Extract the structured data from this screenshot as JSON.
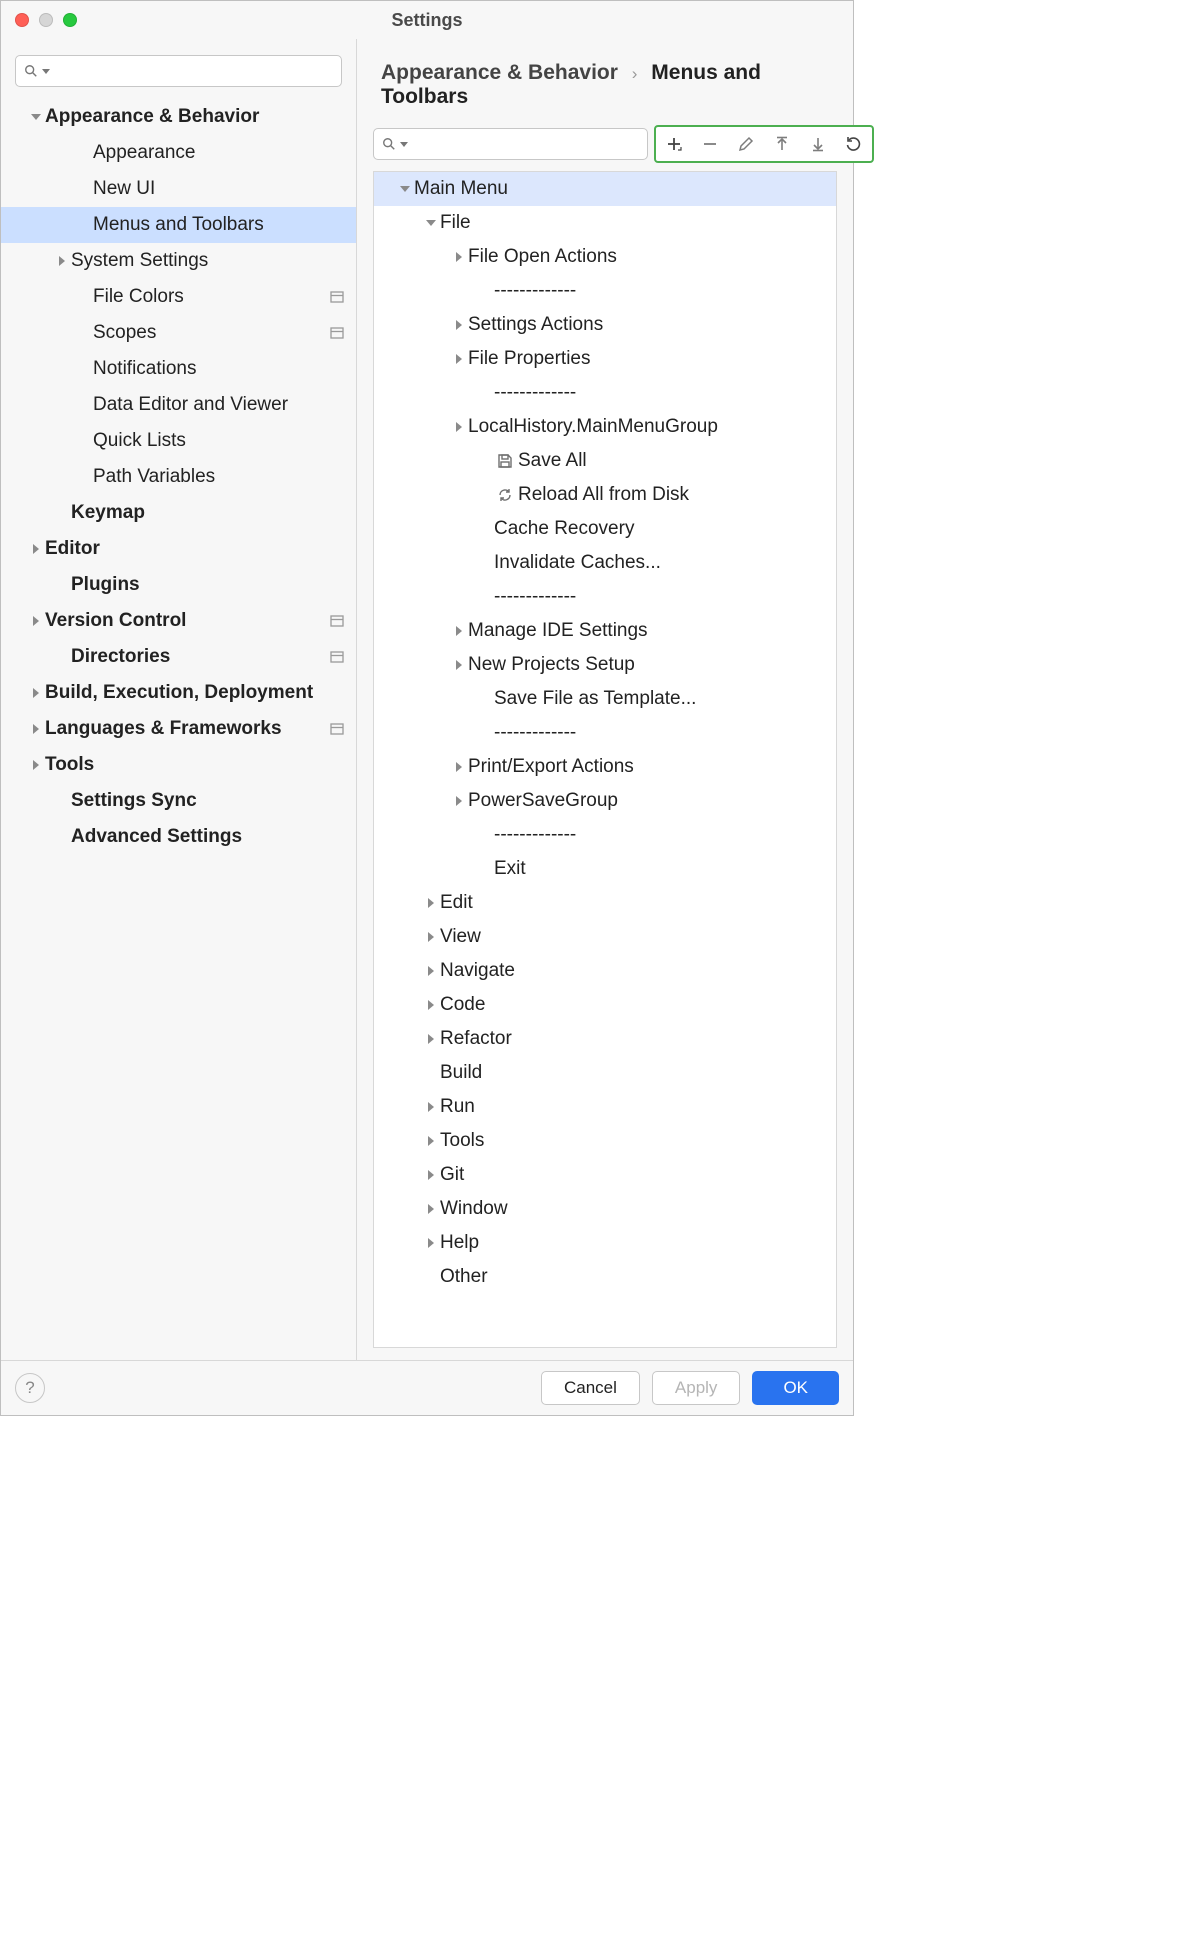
{
  "window": {
    "title": "Settings"
  },
  "breadcrumbs": {
    "parent": "Appearance & Behavior",
    "current": "Menus and Toolbars"
  },
  "sidebar": {
    "search_placeholder": "",
    "nodes": [
      {
        "label": "Appearance & Behavior",
        "bold": true,
        "indent": 0,
        "expander": "down"
      },
      {
        "label": "Appearance",
        "indent": 2
      },
      {
        "label": "New UI",
        "indent": 2
      },
      {
        "label": "Menus and Toolbars",
        "indent": 2,
        "selected": true
      },
      {
        "label": "System Settings",
        "indent": 1,
        "expander": "right"
      },
      {
        "label": "File Colors",
        "indent": 2,
        "tag": true
      },
      {
        "label": "Scopes",
        "indent": 2,
        "tag": true
      },
      {
        "label": "Notifications",
        "indent": 2
      },
      {
        "label": "Data Editor and Viewer",
        "indent": 2
      },
      {
        "label": "Quick Lists",
        "indent": 2
      },
      {
        "label": "Path Variables",
        "indent": 2
      },
      {
        "label": "Keymap",
        "bold": true,
        "indent": 1
      },
      {
        "label": "Editor",
        "bold": true,
        "indent": 0,
        "expander": "right"
      },
      {
        "label": "Plugins",
        "bold": true,
        "indent": 1
      },
      {
        "label": "Version Control",
        "bold": true,
        "indent": 0,
        "expander": "right",
        "tag": true
      },
      {
        "label": "Directories",
        "bold": true,
        "indent": 1,
        "tag": true
      },
      {
        "label": "Build, Execution, Deployment",
        "bold": true,
        "indent": 0,
        "expander": "right"
      },
      {
        "label": "Languages & Frameworks",
        "bold": true,
        "indent": 0,
        "expander": "right",
        "tag": true
      },
      {
        "label": "Tools",
        "bold": true,
        "indent": 0,
        "expander": "right"
      },
      {
        "label": "Settings Sync",
        "bold": true,
        "indent": 1
      },
      {
        "label": "Advanced Settings",
        "bold": true,
        "indent": 1
      }
    ]
  },
  "toolbar": {
    "buttons": [
      {
        "name": "add",
        "enabled": true
      },
      {
        "name": "remove",
        "enabled": false
      },
      {
        "name": "edit",
        "enabled": false
      },
      {
        "name": "move-up",
        "enabled": false
      },
      {
        "name": "move-down",
        "enabled": false
      },
      {
        "name": "restore",
        "enabled": true
      }
    ]
  },
  "menu_tree": [
    {
      "label": "Main Menu",
      "indent": 1,
      "expander": "down",
      "selected": true
    },
    {
      "label": "File",
      "indent": 2,
      "expander": "down"
    },
    {
      "label": "File Open Actions",
      "indent": 3,
      "expander": "right"
    },
    {
      "label": "-------------",
      "indent": 4
    },
    {
      "label": "Settings Actions",
      "indent": 3,
      "expander": "right"
    },
    {
      "label": "File Properties",
      "indent": 3,
      "expander": "right"
    },
    {
      "label": "-------------",
      "indent": 4
    },
    {
      "label": "LocalHistory.MainMenuGroup",
      "indent": 3,
      "expander": "right"
    },
    {
      "label": "Save All",
      "indent": 4,
      "icon": "save"
    },
    {
      "label": "Reload All from Disk",
      "indent": 4,
      "icon": "reload"
    },
    {
      "label": "Cache Recovery",
      "indent": 4
    },
    {
      "label": "Invalidate Caches...",
      "indent": 4
    },
    {
      "label": "-------------",
      "indent": 4
    },
    {
      "label": "Manage IDE Settings",
      "indent": 3,
      "expander": "right"
    },
    {
      "label": "New Projects Setup",
      "indent": 3,
      "expander": "right"
    },
    {
      "label": "Save File as Template...",
      "indent": 4
    },
    {
      "label": "-------------",
      "indent": 4
    },
    {
      "label": "Print/Export Actions",
      "indent": 3,
      "expander": "right"
    },
    {
      "label": "PowerSaveGroup",
      "indent": 3,
      "expander": "right"
    },
    {
      "label": "-------------",
      "indent": 4
    },
    {
      "label": "Exit",
      "indent": 4
    },
    {
      "label": "Edit",
      "indent": 2,
      "expander": "right"
    },
    {
      "label": "View",
      "indent": 2,
      "expander": "right"
    },
    {
      "label": "Navigate",
      "indent": 2,
      "expander": "right"
    },
    {
      "label": "Code",
      "indent": 2,
      "expander": "right"
    },
    {
      "label": "Refactor",
      "indent": 2,
      "expander": "right"
    },
    {
      "label": "Build",
      "indent": 2
    },
    {
      "label": "Run",
      "indent": 2,
      "expander": "right"
    },
    {
      "label": "Tools",
      "indent": 2,
      "expander": "right"
    },
    {
      "label": "Git",
      "indent": 2,
      "expander": "right"
    },
    {
      "label": "Window",
      "indent": 2,
      "expander": "right"
    },
    {
      "label": "Help",
      "indent": 2,
      "expander": "right"
    },
    {
      "label": "Other",
      "indent": 2
    }
  ],
  "footer": {
    "cancel": "Cancel",
    "apply": "Apply",
    "ok": "OK"
  }
}
